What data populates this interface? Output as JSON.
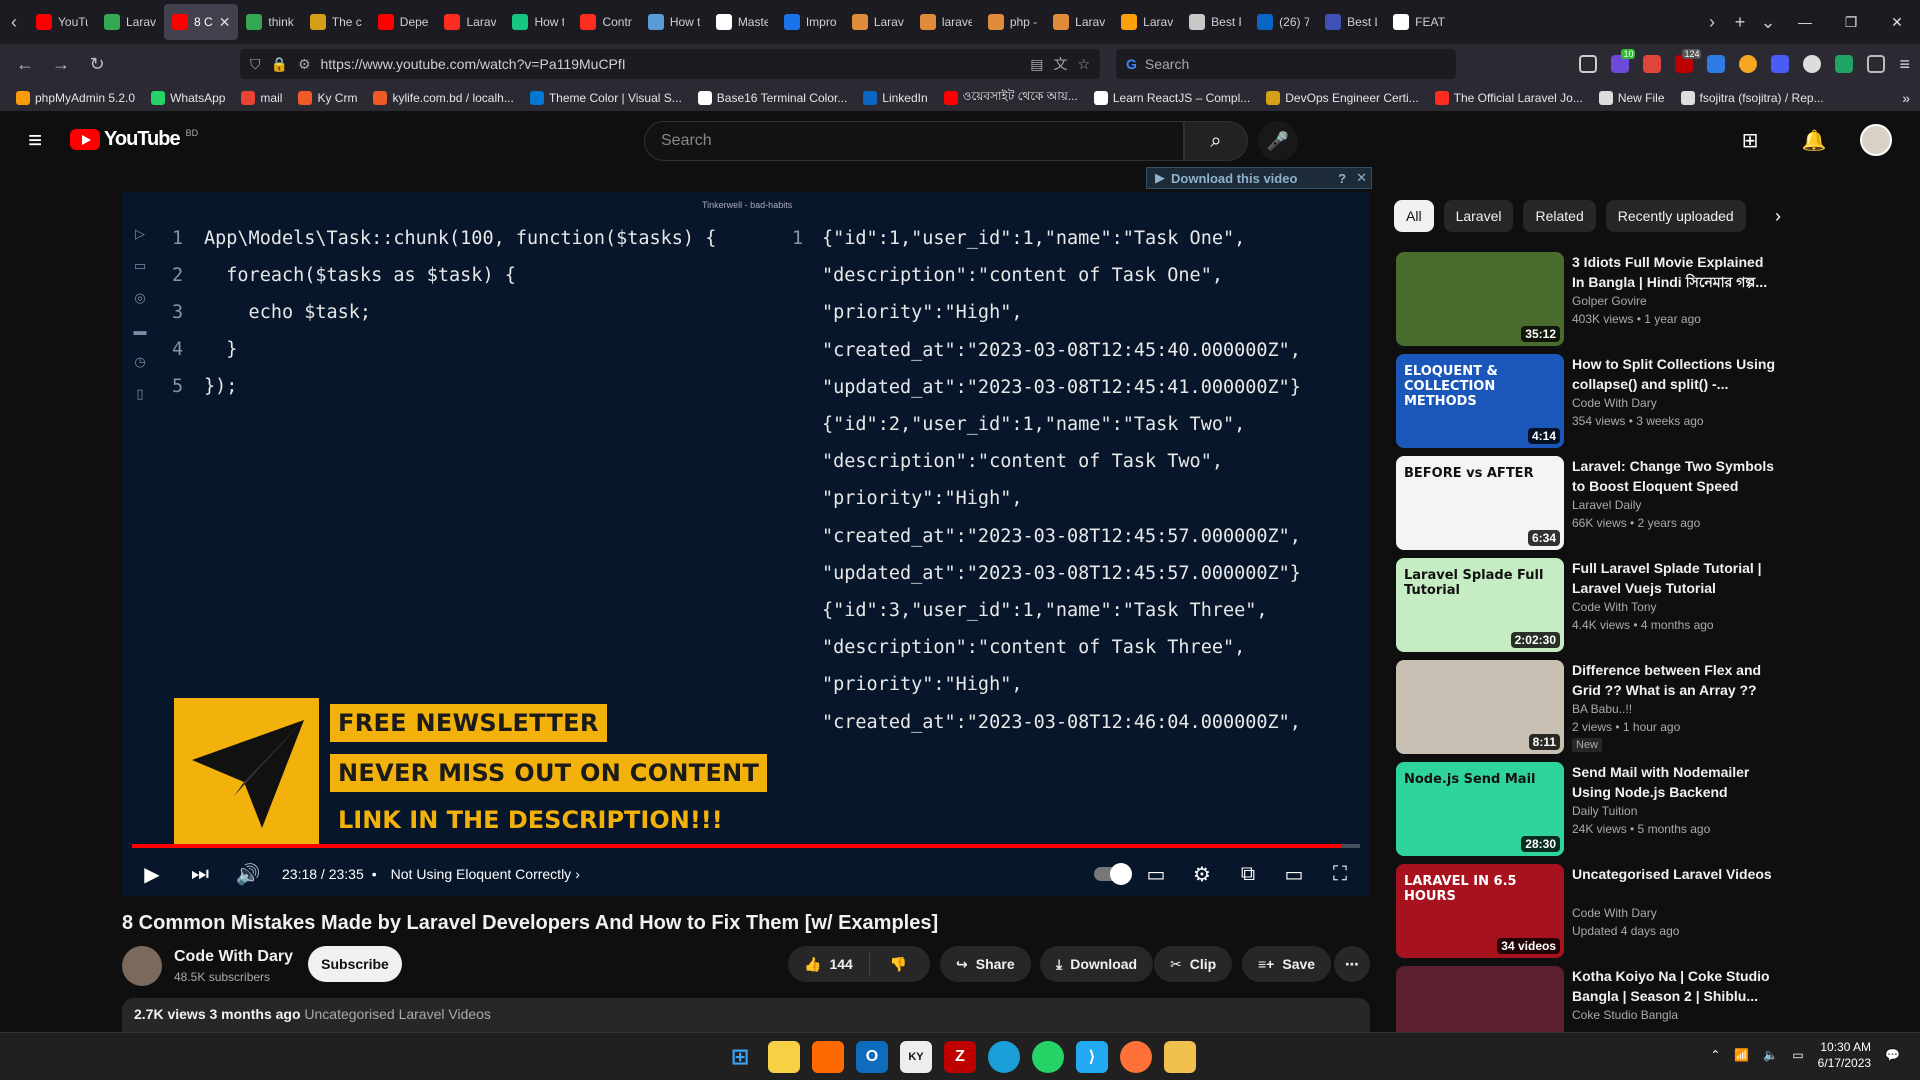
{
  "browser": {
    "tabs": [
      {
        "label": "YouTu",
        "color": "#ff0000"
      },
      {
        "label": "Larav",
        "color": "#34a853"
      },
      {
        "label": "8 C",
        "color": "#ff0000",
        "active": true
      },
      {
        "label": "think",
        "color": "#34a853"
      },
      {
        "label": "The c",
        "color": "#d4a017"
      },
      {
        "label": "Depe",
        "color": "#ff0000"
      },
      {
        "label": "Larav",
        "color": "#ff2d20"
      },
      {
        "label": "How t",
        "color": "#16c784"
      },
      {
        "label": "Contr",
        "color": "#ff2d20"
      },
      {
        "label": "How t",
        "color": "#5b9bd5"
      },
      {
        "label": "Maste",
        "color": "#ffffff"
      },
      {
        "label": "Impro",
        "color": "#1a73e8"
      },
      {
        "label": "Larav",
        "color": "#e08a3c"
      },
      {
        "label": "larave",
        "color": "#e08a3c"
      },
      {
        "label": "php -",
        "color": "#e08a3c"
      },
      {
        "label": "Larav",
        "color": "#e08a3c"
      },
      {
        "label": "Larav",
        "color": "#ff9f0a"
      },
      {
        "label": "Best P",
        "color": "#c7c7c7"
      },
      {
        "label": "(26) 7",
        "color": "#0a66c2"
      },
      {
        "label": "Best L",
        "color": "#3f51b5"
      },
      {
        "label": "FEATU",
        "color": "#ffffff"
      }
    ],
    "url": "https://www.youtube.com/watch?v=Pa119MuCPfI",
    "search_placeholder": "Search",
    "ext_badges": [
      "10",
      "124"
    ],
    "bookmarks": [
      {
        "label": "phpMyAdmin 5.2.0",
        "color": "#f89c0e"
      },
      {
        "label": "WhatsApp",
        "color": "#25d366"
      },
      {
        "label": "mail",
        "color": "#ea4335"
      },
      {
        "label": "Ky Crm",
        "color": "#f05a28"
      },
      {
        "label": "kylife.com.bd / localh...",
        "color": "#f05a28"
      },
      {
        "label": "Theme Color | Visual S...",
        "color": "#0078d4"
      },
      {
        "label": "Base16 Terminal Color...",
        "color": "#ffffff"
      },
      {
        "label": "LinkedIn",
        "color": "#0a66c2"
      },
      {
        "label": "ওয়েবসাইট থেকে আয়...",
        "color": "#ff0000"
      },
      {
        "label": "Learn ReactJS – Compl...",
        "color": "#ffffff"
      },
      {
        "label": "DevOps Engineer Certi...",
        "color": "#d4a017"
      },
      {
        "label": "The Official Laravel Jo...",
        "color": "#ff2d20"
      },
      {
        "label": "New File",
        "color": "#dddddd"
      },
      {
        "label": "fsojitra (fsojitra) / Rep...",
        "color": "#dddddd"
      }
    ]
  },
  "youtube": {
    "logo_text": "YouTube",
    "country_code": "BD",
    "search_placeholder": "Search"
  },
  "player": {
    "download_bar": "Download this video",
    "tinkerwell_title": "Tinkerwell - bad-habits",
    "code_lines": [
      {
        "num": "1",
        "text": "App\\Models\\Task::chunk(100, function($tasks) {"
      },
      {
        "num": "2",
        "text": "  foreach($tasks as $task) {"
      },
      {
        "num": "3",
        "text": "    echo $task;"
      },
      {
        "num": "4",
        "text": "  }"
      },
      {
        "num": "5",
        "text": "});"
      }
    ],
    "output_num": "1",
    "output_lines": [
      "{\"id\":1,\"user_id\":1,\"name\":\"Task One\",",
      "\"description\":\"content of Task One\",",
      "\"priority\":\"High\",",
      "\"created_at\":\"2023-03-08T12:45:40.000000Z\",",
      "\"updated_at\":\"2023-03-08T12:45:41.000000Z\"}",
      "{\"id\":2,\"user_id\":1,\"name\":\"Task Two\",",
      "\"description\":\"content of Task Two\",",
      "\"priority\":\"High\",",
      "\"created_at\":\"2023-03-08T12:45:57.000000Z\",",
      "\"updated_at\":\"2023-03-08T12:45:57.000000Z\"}",
      "{\"id\":3,\"user_id\":1,\"name\":\"Task Three\",",
      "\"description\":\"content of Task Three\",",
      "\"priority\":\"High\",",
      "\"created_at\":\"2023-03-08T12:46:04.000000Z\","
    ],
    "promo": [
      "FREE NEWSLETTER",
      "NEVER MISS OUT ON CONTENT",
      "LINK IN THE DESCRIPTION!!!"
    ],
    "progress_fraction": 0.985,
    "time": "23:18 / 23:35",
    "chapter": "Not Using Eloquent Correctly"
  },
  "video": {
    "title": "8 Common Mistakes Made by Laravel Developers And How to Fix Them [w/ Examples]",
    "channel": "Code With Dary",
    "subscribers": "48.5K subscribers",
    "subscribe_label": "Subscribe",
    "likes": "144",
    "share_label": "Share",
    "download_label": "Download",
    "clip_label": "Clip",
    "save_label": "Save",
    "views": "2.7K views",
    "age": "3 months ago",
    "category": "Uncategorised Laravel Videos"
  },
  "sidebar": {
    "chips": [
      "All",
      "Laravel",
      "Related",
      "Recently uploaded"
    ],
    "recommendations": [
      {
        "title": "3 Idiots Full Movie Explained In Bangla | Hindi সিনেমার গল্প...",
        "channel": "Golper Govire",
        "meta": "403K views • 1 year ago",
        "duration": "35:12",
        "thumb_color": "#4a6b2e"
      },
      {
        "title": "How to Split Collections Using collapse() and split() -...",
        "channel": "Code With Dary",
        "meta": "354 views • 3 weeks ago",
        "duration": "4:14",
        "thumb_color": "#1a57b8",
        "thumb_text": "ELOQUENT & COLLECTION METHODS"
      },
      {
        "title": "Laravel: Change Two Symbols to Boost Eloquent Speed",
        "channel": "Laravel Daily",
        "meta": "66K views • 2 years ago",
        "duration": "6:34",
        "thumb_color": "#f4f4f4",
        "thumb_text": "BEFORE vs AFTER"
      },
      {
        "title": "Full Laravel Splade Tutorial | Laravel Vuejs Tutorial",
        "channel": "Code With Tony",
        "meta": "4.4K views • 4 months ago",
        "duration": "2:02:30",
        "thumb_color": "#c6ecc4",
        "thumb_text": "Laravel Splade Full Tutorial"
      },
      {
        "title": "Difference between Flex and Grid ?? What is an Array ?? Wh...",
        "channel": "BA Babu..!!",
        "meta": "2 views • 1 hour ago",
        "duration": "8:11",
        "badge": "New",
        "thumb_color": "#c8c1b3"
      },
      {
        "title": "Send Mail with Nodemailer Using Node.js Backend",
        "channel": "Daily Tuition",
        "meta": "24K views • 5 months ago",
        "duration": "28:30",
        "thumb_color": "#2fd49a",
        "thumb_text": "Node.js Send Mail"
      },
      {
        "title": "Uncategorised Laravel Videos",
        "channel": "Code With Dary",
        "meta": "Updated 4 days ago",
        "duration": "34 videos",
        "thumb_color": "#a8121e",
        "thumb_text": "LARAVEL IN 6.5 HOURS"
      },
      {
        "title": "Kotha Koiyo Na | Coke Studio Bangla | Season 2 | Shiblu...",
        "channel": "Coke Studio Bangla",
        "meta": "",
        "duration": "",
        "thumb_color": "#5c1f2f"
      }
    ]
  },
  "taskbar": {
    "time": "10:30 AM",
    "date": "6/17/2023"
  }
}
